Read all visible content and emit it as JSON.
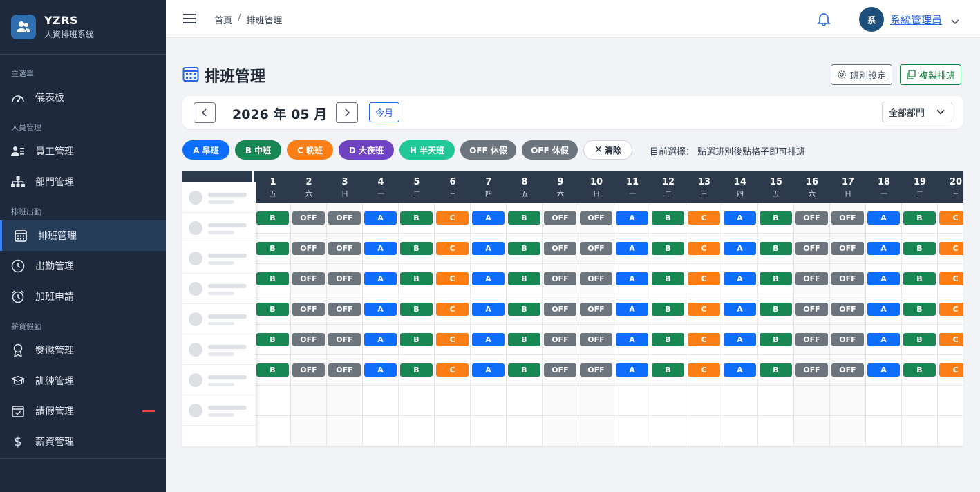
{
  "brand": {
    "name": "YZRS",
    "subtitle": "人資排班系統"
  },
  "sidebar": {
    "sections": [
      {
        "label": "主選單",
        "items": [
          {
            "label": "儀表板",
            "icon": "dashboard-icon"
          }
        ]
      },
      {
        "label": "人員管理",
        "items": [
          {
            "label": "員工管理",
            "icon": "users-icon"
          },
          {
            "label": "部門管理",
            "icon": "sitemap-icon"
          }
        ]
      },
      {
        "label": "排班出勤",
        "items": [
          {
            "label": "排班管理",
            "icon": "calendar-icon",
            "active": true
          },
          {
            "label": "出勤管理",
            "icon": "clock-icon"
          },
          {
            "label": "加班申請",
            "icon": "alarm-icon"
          }
        ]
      },
      {
        "label": "薪資假勤",
        "items": [
          {
            "label": "獎懲管理",
            "icon": "award-icon"
          },
          {
            "label": "訓練管理",
            "icon": "graduation-icon"
          },
          {
            "label": "請假管理",
            "icon": "calendar-check-icon",
            "badge": true
          },
          {
            "label": "薪資管理",
            "icon": "dollar-icon"
          }
        ]
      }
    ]
  },
  "header": {
    "breadcrumb": [
      "首頁",
      "排班管理"
    ],
    "breadcrumb_sep": "/",
    "user": {
      "avatar": "系",
      "name": "系統管理員"
    }
  },
  "page": {
    "title": "排班管理",
    "btn_shift_settings": "班別設定",
    "btn_copy_schedule": "複製排班"
  },
  "month_bar": {
    "label": "2026 年 05 月",
    "today": "今月",
    "department": "全部部門"
  },
  "chips": [
    {
      "label": "A 早班",
      "color": "#0d6efd"
    },
    {
      "label": "B 中班",
      "color": "#198754"
    },
    {
      "label": "C 晚班",
      "color": "#fd7e14"
    },
    {
      "label": "D 大夜班",
      "color": "#6f42c1"
    },
    {
      "label": "H 半天班",
      "color": "#20c997"
    },
    {
      "label": "OFF 休假",
      "color": "#6c757d"
    },
    {
      "label": "OFF 休假",
      "color": "#6c757d"
    }
  ],
  "clear_label": "清除",
  "hint": "目前選擇： 點選班別後點格子即可排班",
  "colors": {
    "A": "#0d6efd",
    "B": "#198754",
    "C": "#fd7e14",
    "OFF": "#6c757d"
  },
  "days": [
    {
      "d": "1",
      "w": "五"
    },
    {
      "d": "2",
      "w": "六"
    },
    {
      "d": "3",
      "w": "日"
    },
    {
      "d": "4",
      "w": "一"
    },
    {
      "d": "5",
      "w": "二"
    },
    {
      "d": "6",
      "w": "三"
    },
    {
      "d": "7",
      "w": "四"
    },
    {
      "d": "8",
      "w": "五"
    },
    {
      "d": "9",
      "w": "六"
    },
    {
      "d": "10",
      "w": "日"
    },
    {
      "d": "11",
      "w": "一"
    },
    {
      "d": "12",
      "w": "二"
    },
    {
      "d": "13",
      "w": "三"
    },
    {
      "d": "14",
      "w": "四"
    },
    {
      "d": "15",
      "w": "五"
    },
    {
      "d": "16",
      "w": "六"
    },
    {
      "d": "17",
      "w": "日"
    },
    {
      "d": "18",
      "w": "一"
    },
    {
      "d": "19",
      "w": "二"
    },
    {
      "d": "20",
      "w": "三"
    }
  ],
  "schedule_rows": [
    [
      "B",
      "OFF",
      "OFF",
      "A",
      "B",
      "C",
      "A",
      "B",
      "OFF",
      "OFF",
      "A",
      "B",
      "C",
      "A",
      "B",
      "OFF",
      "OFF",
      "A",
      "B",
      "C"
    ],
    [
      "B",
      "OFF",
      "OFF",
      "A",
      "B",
      "C",
      "A",
      "B",
      "OFF",
      "OFF",
      "A",
      "B",
      "C",
      "A",
      "B",
      "OFF",
      "OFF",
      "A",
      "B",
      "C"
    ],
    [
      "B",
      "OFF",
      "OFF",
      "A",
      "B",
      "C",
      "A",
      "B",
      "OFF",
      "OFF",
      "A",
      "B",
      "C",
      "A",
      "B",
      "OFF",
      "OFF",
      "A",
      "B",
      "C"
    ],
    [
      "B",
      "OFF",
      "OFF",
      "A",
      "B",
      "C",
      "A",
      "B",
      "OFF",
      "OFF",
      "A",
      "B",
      "C",
      "A",
      "B",
      "OFF",
      "OFF",
      "A",
      "B",
      "C"
    ],
    [
      "B",
      "OFF",
      "OFF",
      "A",
      "B",
      "C",
      "A",
      "B",
      "OFF",
      "OFF",
      "A",
      "B",
      "C",
      "A",
      "B",
      "OFF",
      "OFF",
      "A",
      "B",
      "C"
    ],
    [
      "B",
      "OFF",
      "OFF",
      "A",
      "B",
      "C",
      "A",
      "B",
      "OFF",
      "OFF",
      "A",
      "B",
      "C",
      "A",
      "B",
      "OFF",
      "OFF",
      "A",
      "B",
      "C"
    ],
    [],
    []
  ],
  "employee_placeholders": 8
}
